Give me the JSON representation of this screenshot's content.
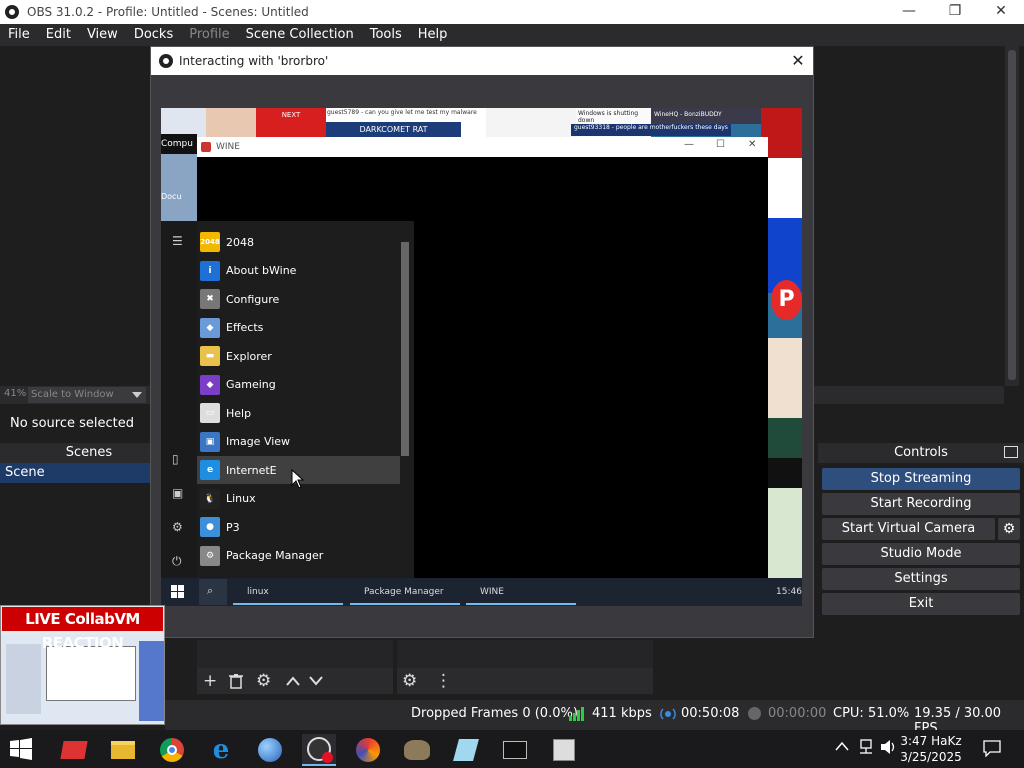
{
  "window": {
    "title": "OBS 31.0.2 - Profile: Untitled - Scenes: Untitled",
    "minimize": "—",
    "maximize": "❐",
    "close": "✕"
  },
  "menu": [
    "File",
    "Edit",
    "View",
    "Docks",
    "Profile",
    "Scene Collection",
    "Tools",
    "Help"
  ],
  "preview": {
    "zoom_percent": "41%",
    "zoom_mode": "Scale to Window",
    "no_source": "No source selected"
  },
  "dialog": {
    "title": "Interacting with 'brorbro'",
    "close": "✕"
  },
  "vm": {
    "window_title": "WINE",
    "win_ctrls": [
      "—",
      "☐",
      "✕"
    ],
    "start_menu_items": [
      {
        "label": "2048",
        "icon": "2048-icon",
        "color": "#f2b800",
        "glyph": "2048"
      },
      {
        "label": "About bWine",
        "icon": "info-icon",
        "color": "#1e6fd6",
        "glyph": "i"
      },
      {
        "label": "Configure",
        "icon": "tools-icon",
        "color": "#777777",
        "glyph": "✖"
      },
      {
        "label": "Effects",
        "icon": "effects-icon",
        "color": "#6a9bd8",
        "glyph": "◆"
      },
      {
        "label": "Explorer",
        "icon": "folder-icon",
        "color": "#e8c24a",
        "glyph": "▬"
      },
      {
        "label": "Gameing",
        "icon": "cube-icon",
        "color": "#7b3fc7",
        "glyph": "◆"
      },
      {
        "label": "Help",
        "icon": "document-icon",
        "color": "#dddddd",
        "glyph": "▭"
      },
      {
        "label": "Image View",
        "icon": "image-icon",
        "color": "#3a76c4",
        "glyph": "▣"
      },
      {
        "label": "InternetE",
        "icon": "ie-icon",
        "color": "#1e8fe0",
        "glyph": "e"
      },
      {
        "label": "Linux",
        "icon": "penguin-icon",
        "color": "#222222",
        "glyph": "🐧"
      },
      {
        "label": "P3",
        "icon": "globe-icon",
        "color": "#3c8fd8",
        "glyph": "●"
      },
      {
        "label": "Package Manager",
        "icon": "package-icon",
        "color": "#888888",
        "glyph": "⚙"
      }
    ],
    "taskbar_items": [
      "linux",
      "Package Manager",
      "WINE"
    ],
    "clock": "15:46",
    "wallpaper_texts": [
      "Compu",
      "NEXT",
      "guest5789 - can you give let me test my malware",
      "DARKCOMET RAT",
      "Windows is shutting down",
      "guest93318 - people are motherfuckers these days",
      "WineHQ - BonziBUDDY",
      "Docu"
    ]
  },
  "overlay": {
    "banner": "LIVE CollabVM REACTION"
  },
  "docks": {
    "scenes_title": "Scenes",
    "scene_item": "Scene",
    "controls_title": "Controls",
    "controls": [
      "Stop Streaming",
      "Start Recording",
      "Start Virtual Camera",
      "Studio Mode",
      "Settings",
      "Exit"
    ]
  },
  "status": {
    "dropped": "Dropped Frames 0 (0.0%)",
    "bitrate": "411 kbps",
    "stream_time": "00:50:08",
    "rec_time": "00:00:00",
    "cpu": "CPU: 51.0%",
    "fps": "19.35 / 30.00 FPS"
  },
  "taskbar": {
    "apps": [
      "app-red-icon",
      "file-explorer-icon",
      "chrome-icon",
      "ie-icon",
      "globe-icon",
      "obs-icon",
      "swirl-icon",
      "gimp-icon",
      "notepad-icon",
      "terminal-icon",
      "package-icon"
    ],
    "time": "3:47 HaKz",
    "date": "3/25/2025"
  }
}
